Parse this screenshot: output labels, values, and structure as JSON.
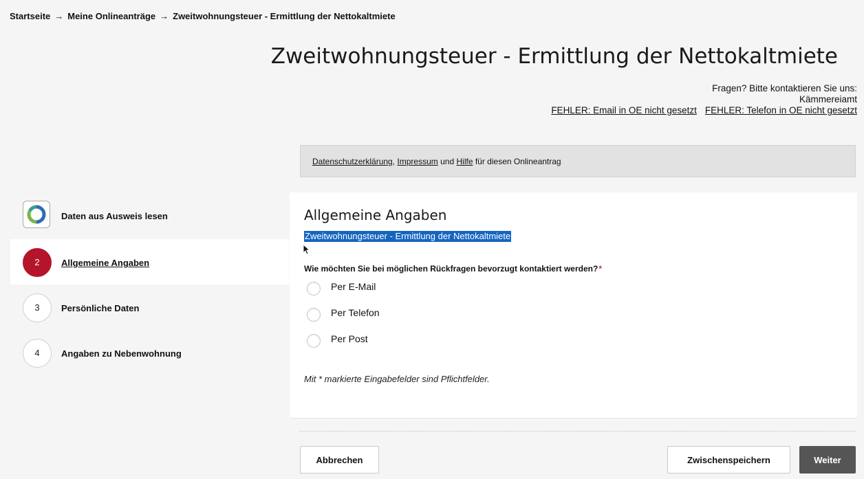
{
  "breadcrumb": {
    "home": "Startseite",
    "separator": "→",
    "level1": "Meine Onlineanträge",
    "current": "Zweitwohnungsteuer - Ermittlung der Nettokaltmiete"
  },
  "page": {
    "title": "Zweitwohnungsteuer - Ermittlung der Nettokaltmiete"
  },
  "contact": {
    "intro": "Fragen? Bitte kontaktieren Sie uns:",
    "department": "Kämmereiamt",
    "email_link": "FEHLER: Email in OE nicht gesetzt",
    "phone_link": "FEHLER: Telefon in OE nicht gesetzt"
  },
  "info_bar": {
    "privacy_link": "Datenschutzerklärung",
    "comma": ",",
    "imprint_link": "Impressum",
    "and": "und",
    "help_link": "Hilfe",
    "suffix": "für diesen Onlineantrag"
  },
  "steps": [
    {
      "number": "",
      "label": "Daten aus Ausweis lesen",
      "icon": "eid-logo-icon"
    },
    {
      "number": "2",
      "label": "Allgemeine Angaben",
      "active": true
    },
    {
      "number": "3",
      "label": "Persönliche Daten"
    },
    {
      "number": "4",
      "label": "Angaben zu Nebenwohnung"
    }
  ],
  "form": {
    "section_title": "Allgemeine Angaben",
    "section_subtitle": "Zweitwohnungsteuer - Ermittlung der Nettokaltmiete",
    "question": "Wie möchten Sie bei möglichen Rückfragen bevorzugt kontaktiert werden?",
    "required_marker": "*",
    "options": [
      "Per E-Mail",
      "Per Telefon",
      "Per Post"
    ],
    "footnote": "Mit * markierte Eingabefelder sind Pflichtfelder."
  },
  "buttons": {
    "cancel": "Abbrechen",
    "save": "Zwischenspeichern",
    "next": "Weiter"
  },
  "colors": {
    "accent": "#b5152b",
    "selection": "#1565c0",
    "primary_button": "#555555"
  }
}
